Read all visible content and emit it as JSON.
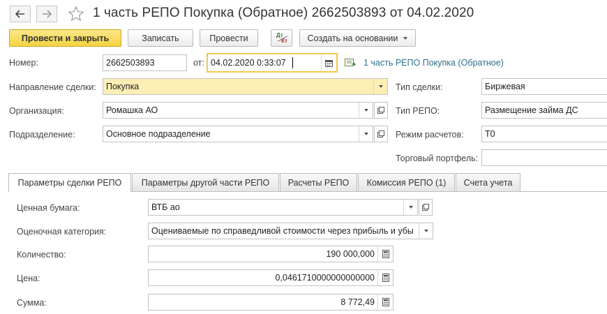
{
  "window": {
    "title": "1 часть РЕПО Покупка (Обратное) 2662503893  от 04.02.2020"
  },
  "toolbar": {
    "post_close_label": "Провести и закрыть",
    "save_label": "Записать",
    "post_label": "Провести",
    "dt_label": "Дт",
    "kt_label": "Кт",
    "create_based_label": "Создать на основании"
  },
  "header": {
    "number_label": "Номер:",
    "number_value": "2662503893",
    "date_label": "от:",
    "date_value": "04.02.2020  0:33:07",
    "linked_doc": "1 часть РЕПО Покупка (Обратное)"
  },
  "form": {
    "direction_label": "Направление сделки:",
    "direction_value": "Покупка",
    "org_label": "Организация:",
    "org_value": "Ромашка АО",
    "division_label": "Подразделение:",
    "division_value": "Основное подразделение",
    "deal_type_label": "Тип сделки:",
    "deal_type_value": "Биржевая",
    "repo_type_label": "Тип РЕПО:",
    "repo_type_value": "Размещение займа ДС",
    "settle_label": "Режим расчетов:",
    "settle_value": "T0",
    "portfolio_label": "Торговый портфель:",
    "portfolio_value": ""
  },
  "tabs": [
    {
      "label": "Параметры сделки РЕПО"
    },
    {
      "label": "Параметры другой части РЕПО"
    },
    {
      "label": "Расчеты РЕПО"
    },
    {
      "label": "Комиссия РЕПО (1)"
    },
    {
      "label": "Счета учета"
    }
  ],
  "params": {
    "security_label": "Ценная бумага:",
    "security_value": "ВТБ ао",
    "category_label": "Оценочная категория:",
    "category_value": "Оцениваемые по справедливой стоимости через прибыль и убы",
    "qty_label": "Количество:",
    "qty_value": "190 000,000",
    "price_label": "Цена:",
    "price_value": "0,0461710000000000000",
    "sum_label": "Сумма:",
    "sum_value": "8 772,49"
  },
  "colors": {
    "primary_button": "#f5d341",
    "highlight_field": "#fdeeb5",
    "link": "#2a6f8a"
  }
}
